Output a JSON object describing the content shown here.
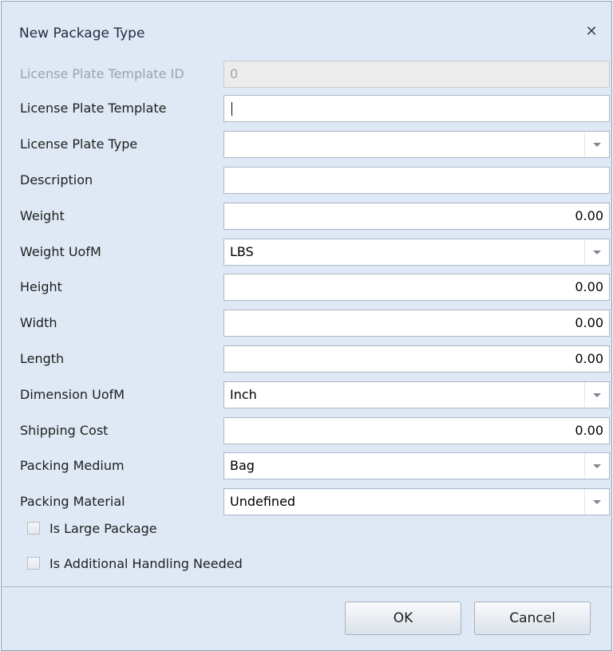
{
  "dialog": {
    "title": "New Package Type",
    "close_symbol": "✕"
  },
  "fields": [
    {
      "label": "License Plate Template ID",
      "value": "0",
      "kind": "text",
      "readonly": true
    },
    {
      "label": "License Plate Template",
      "value": "",
      "kind": "text",
      "focused": true
    },
    {
      "label": "License Plate Type",
      "value": "",
      "kind": "combo"
    },
    {
      "label": "Description",
      "value": "",
      "kind": "text"
    },
    {
      "label": "Weight",
      "value": "0.00",
      "kind": "number"
    },
    {
      "label": "Weight UofM",
      "value": "LBS",
      "kind": "combo"
    },
    {
      "label": "Height",
      "value": "0.00",
      "kind": "number"
    },
    {
      "label": "Width",
      "value": "0.00",
      "kind": "number"
    },
    {
      "label": "Length",
      "value": "0.00",
      "kind": "number"
    },
    {
      "label": "Dimension UofM",
      "value": "Inch",
      "kind": "combo"
    },
    {
      "label": "Shipping Cost",
      "value": "0.00",
      "kind": "number"
    },
    {
      "label": "Packing Medium",
      "value": "Bag",
      "kind": "combo"
    },
    {
      "label": "Packing Material",
      "value": "Undefined",
      "kind": "combo"
    }
  ],
  "checkboxes": [
    {
      "label": "Is Large Package",
      "checked": false
    },
    {
      "label": "Is Additional Handling Needed",
      "checked": false
    }
  ],
  "buttons": {
    "ok": "OK",
    "cancel": "Cancel"
  }
}
